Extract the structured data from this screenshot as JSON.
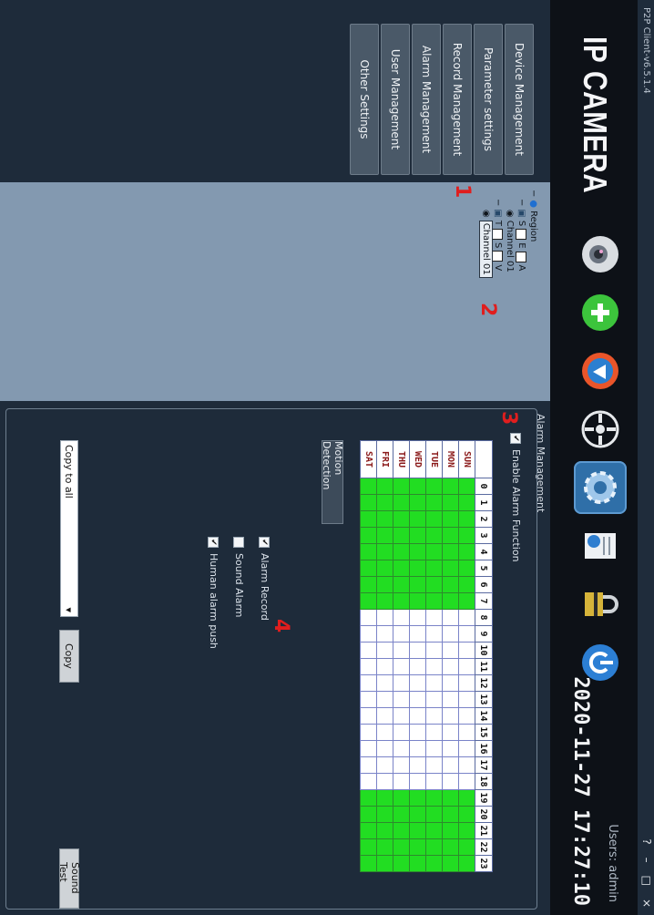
{
  "app": {
    "version": "P2P Client-v6.5.1.4",
    "brand": "IP CAMERA"
  },
  "window_controls": {
    "help": "?",
    "minimize": "–",
    "maximize": "□",
    "close": "×"
  },
  "header": {
    "users": "Users: admin",
    "datetime": "2020-11-27 17:27:10"
  },
  "toolbar": [
    {
      "icon": "camera-icon"
    },
    {
      "icon": "add-icon"
    },
    {
      "icon": "playback-icon"
    },
    {
      "icon": "ptz-icon"
    },
    {
      "icon": "settings-icon",
      "active": true
    },
    {
      "icon": "log-icon"
    },
    {
      "icon": "lock-icon"
    },
    {
      "icon": "power-icon"
    }
  ],
  "sidebar": {
    "items": [
      {
        "label": "Device Management"
      },
      {
        "label": "Parameter settings"
      },
      {
        "label": "Record Management"
      },
      {
        "label": "Alarm Management"
      },
      {
        "label": "User Management"
      },
      {
        "label": "Other Settings"
      }
    ]
  },
  "device_tree": {
    "root": "Region",
    "device1_a": "S",
    "device1_b": "E",
    "device1_c": "A",
    "channel1": "Channel 01",
    "device2_a": "T",
    "device2_b": "S",
    "device2_c": "V",
    "channel2": "Channel 01"
  },
  "markers": {
    "m1": "1",
    "m2": "2",
    "m3": "3",
    "m4": "4"
  },
  "alarm": {
    "section": "Alarm Management",
    "enable_label": "Enable Alarm Function",
    "enable_checked": "✔",
    "days": [
      "SUN",
      "MON",
      "TUE",
      "WED",
      "THU",
      "FRI",
      "SAT"
    ],
    "hours": [
      "0",
      "1",
      "2",
      "3",
      "4",
      "5",
      "6",
      "7",
      "8",
      "9",
      "10",
      "11",
      "12",
      "13",
      "14",
      "15",
      "16",
      "17",
      "18",
      "19",
      "20",
      "21",
      "22",
      "23"
    ],
    "active_hours": [
      0,
      1,
      2,
      3,
      4,
      5,
      6,
      7,
      19,
      20,
      21,
      22,
      23
    ],
    "motion_button": "Motion Detection",
    "options": [
      {
        "label": "Alarm Record",
        "checked": "✔"
      },
      {
        "label": "Sound Alarm",
        "checked": ""
      },
      {
        "label": "Human alarm push",
        "checked": "✔"
      }
    ],
    "copy_select": "Copy to all",
    "copy_button": "Copy",
    "sound_test": "Sound Test"
  },
  "colors": {
    "accent": "#2f6fa8",
    "schedule_on": "#22dd22",
    "marker": "#e01e1e"
  }
}
